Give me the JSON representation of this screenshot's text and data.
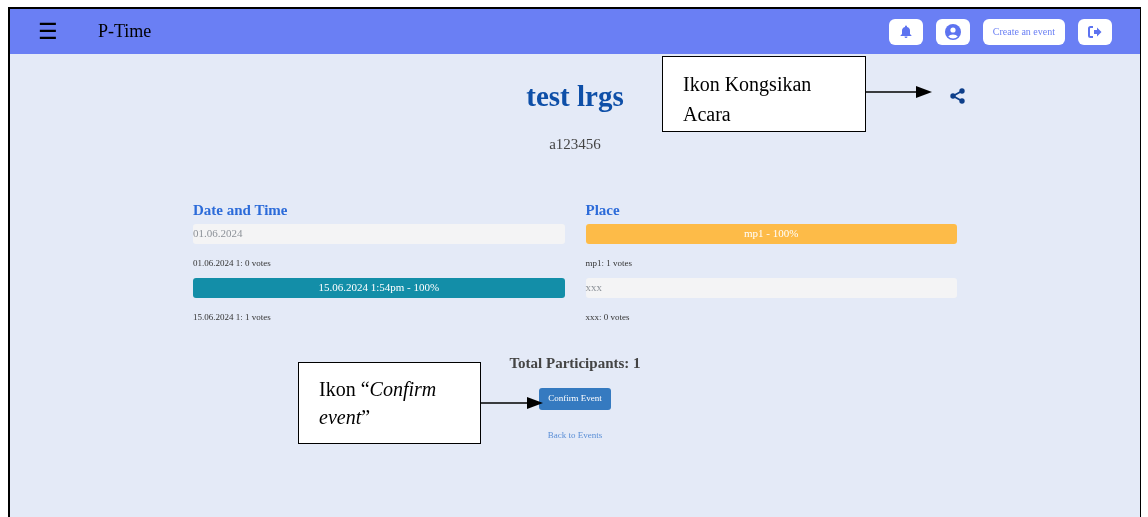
{
  "navbar": {
    "menu_glyph": "☰",
    "brand": "P-Time",
    "create_button": "Create an event"
  },
  "event": {
    "title": "test lrgs",
    "code": "a123456"
  },
  "sections": [
    {
      "kind": "date",
      "heading": "Date and Time",
      "options": [
        {
          "label": "01.06.2024",
          "level": 0,
          "votes": "01.06.2024 1: 0 votes"
        },
        {
          "label": "15.06.2024 1:54pm - 100%",
          "level": 1,
          "votes": "15.06.2024 1: 1 votes"
        }
      ]
    },
    {
      "kind": "place",
      "heading": "Place",
      "options": [
        {
          "label": "mp1 - 100%",
          "level": 1,
          "votes": "mp1: 1 votes"
        },
        {
          "label": "xxx",
          "level": 0,
          "votes": "xxx: 0 votes"
        }
      ]
    }
  ],
  "total": "Total Participants: 1",
  "confirm_button": "Confirm Event",
  "back_link": "Back to Events",
  "annotations": [
    {
      "kind": "share",
      "text": "Ikon Kongsikan Acara"
    },
    {
      "kind": "confirm",
      "text": "Ikon “*Confirm event*”"
    }
  ]
}
